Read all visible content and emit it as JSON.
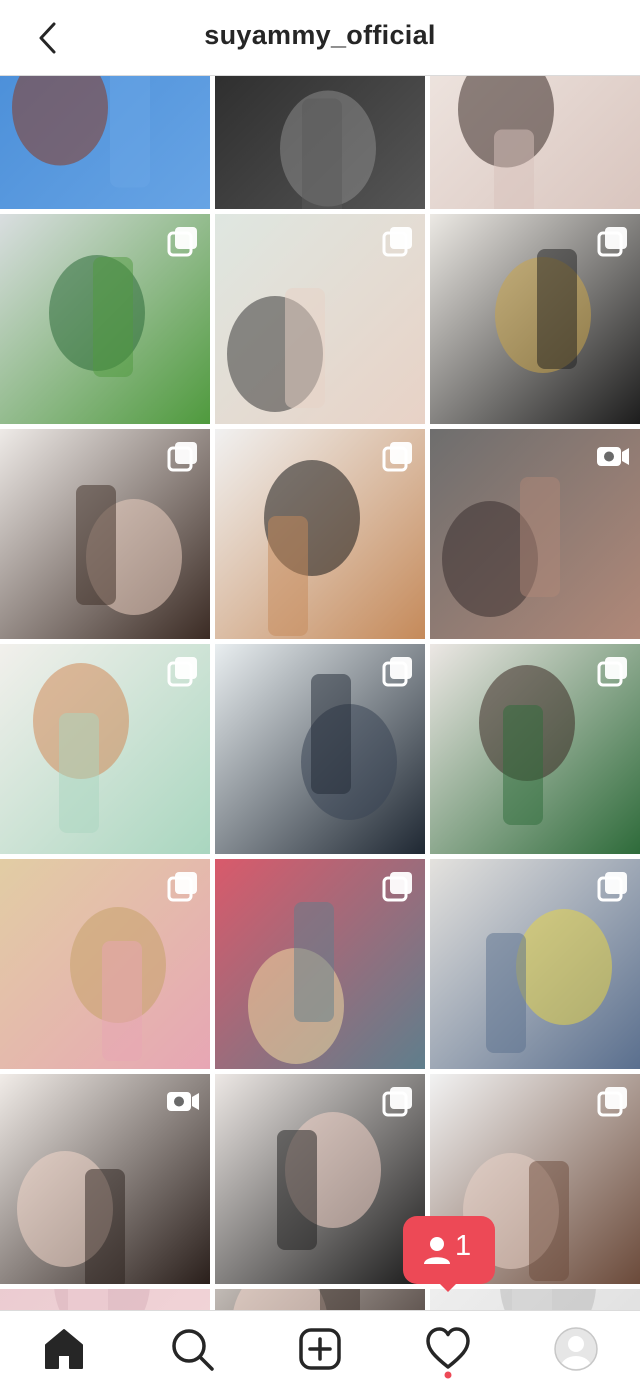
{
  "header": {
    "title": "suyammy_official",
    "back_icon": "chevron-left-icon"
  },
  "grid": {
    "rows": [
      {
        "posts": [
          {
            "badge": "none",
            "scene": "hand holding amber serum bottle against blue sky",
            "colors": [
              "#4a8ed8",
              "#6aa6e6",
              "#8a3b22"
            ]
          },
          {
            "badge": "none",
            "scene": "black and white fashion photo",
            "colors": [
              "#2b2b2b",
              "#5a5a5a",
              "#8a8a8a"
            ]
          },
          {
            "badge": "none",
            "scene": "woman applying lip tint",
            "colors": [
              "#efe6e1",
              "#d7c2bb",
              "#3a2c28"
            ]
          }
        ]
      },
      {
        "posts": [
          {
            "badge": "carousel",
            "scene": "green toiletry bottles on shelf with plants",
            "colors": [
              "#d9dee0",
              "#4f9a3d",
              "#2d6b3a"
            ]
          },
          {
            "badge": "carousel",
            "scene": "eyeshadow pots and woman close-up",
            "colors": [
              "#dfe7e1",
              "#e8d2c6",
              "#3a3a3a"
            ]
          },
          {
            "badge": "carousel",
            "scene": "hand holding cushion compact",
            "colors": [
              "#ece9e4",
              "#1d1d1d",
              "#c9a44b"
            ]
          }
        ]
      },
      {
        "posts": [
          {
            "badge": "carousel",
            "scene": "woman with headband holding compact",
            "colors": [
              "#eeeae7",
              "#3b2b24",
              "#e9cdbf"
            ]
          },
          {
            "badge": "carousel",
            "scene": "cream eyeshadow pots with brush",
            "colors": [
              "#f1f1f1",
              "#c58a5a",
              "#1c1c1c"
            ]
          },
          {
            "badge": "video",
            "scene": "lip gloss tube close-up",
            "colors": [
              "#6e6e6e",
              "#b08878",
              "#3b3030"
            ]
          }
        ]
      },
      {
        "posts": [
          {
            "badge": "carousel",
            "scene": "mint tube with candles",
            "colors": [
              "#f2f0ec",
              "#a9d6bf",
              "#d28a5a"
            ]
          },
          {
            "badge": "carousel",
            "scene": "dark skincare gift box set",
            "colors": [
              "#e9eef0",
              "#1f2833",
              "#3a4656"
            ]
          },
          {
            "badge": "carousel",
            "scene": "woman holding green serum bottle",
            "colors": [
              "#ece7e4",
              "#2e6b3a",
              "#3d2a24"
            ]
          }
        ]
      },
      {
        "posts": [
          {
            "badge": "carousel",
            "scene": "pink palettes on newspaper with waffles",
            "colors": [
              "#e2cda4",
              "#e7a6b4",
              "#c7a26a"
            ]
          },
          {
            "badge": "carousel",
            "scene": "cheese platter with wine",
            "colors": [
              "#d95a6b",
              "#5f7e8c",
              "#f0d9a0"
            ]
          },
          {
            "badge": "carousel",
            "scene": "gingham outfit with yellow bag",
            "colors": [
              "#e4e2de",
              "#5a6f8e",
              "#e6d34a"
            ]
          }
        ]
      },
      {
        "posts": [
          {
            "badge": "video",
            "scene": "mother and daughter portrait",
            "colors": [
              "#f1ece8",
              "#2a1f1b",
              "#f3d7cb"
            ]
          },
          {
            "badge": "carousel",
            "scene": "woman with zebra compact",
            "colors": [
              "#ede8e5",
              "#1b1b1b",
              "#f0d2c6"
            ]
          },
          {
            "badge": "carousel",
            "scene": "brow pencils and eye close-up",
            "colors": [
              "#f2f2f2",
              "#6b4a3a",
              "#e9d2c7"
            ]
          }
        ]
      },
      {
        "posts": [
          {
            "badge": "none",
            "scene": "partial next row",
            "colors": [
              "#e9c9cf",
              "#f3d6d9",
              "#d9b3bc"
            ]
          },
          {
            "badge": "none",
            "scene": "partial next row",
            "colors": [
              "#e6e1dc",
              "#3a2d28",
              "#f0d6cb"
            ]
          },
          {
            "badge": "none",
            "scene": "partial next row",
            "colors": [
              "#f3f3f3",
              "#dcdcdc",
              "#bcbcbc"
            ]
          }
        ]
      }
    ]
  },
  "notification": {
    "count": "1",
    "icon": "person-icon",
    "color": "#ed4956"
  },
  "bottom_nav": {
    "items": [
      {
        "name": "home",
        "icon": "home-icon",
        "active": true
      },
      {
        "name": "search",
        "icon": "search-icon",
        "active": false
      },
      {
        "name": "new-post",
        "icon": "plus-square-icon",
        "active": false
      },
      {
        "name": "activity",
        "icon": "heart-icon",
        "active": false,
        "dot_color": "#ed4956"
      },
      {
        "name": "profile",
        "icon": "avatar-icon",
        "active": false
      }
    ]
  },
  "colors": {
    "text": "#262626",
    "divider": "#dbdbdb",
    "accent": "#ed4956"
  }
}
